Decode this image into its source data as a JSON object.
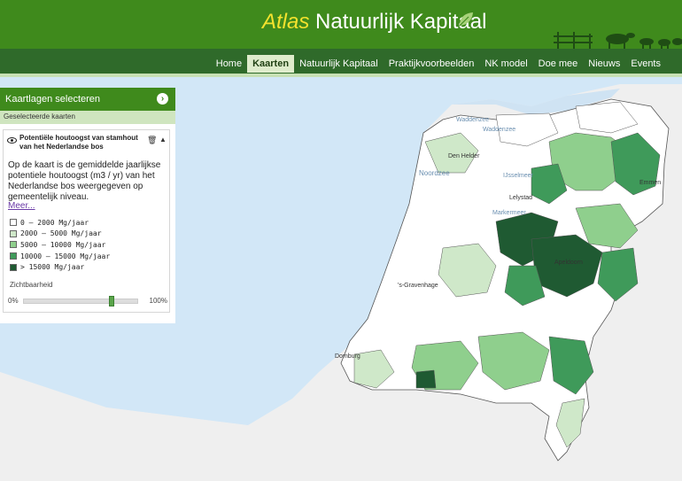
{
  "header": {
    "title_atlas": "Atlas",
    "title_rest": "Natuurlijk Kapitaal",
    "brand_color": "#3f8a1c",
    "accent_color": "#f3e22e"
  },
  "nav": {
    "items": [
      {
        "label": "Home",
        "active": false
      },
      {
        "label": "Kaarten",
        "active": true
      },
      {
        "label": "Natuurlijk Kapitaal",
        "active": false
      },
      {
        "label": "Praktijkvoorbeelden",
        "active": false
      },
      {
        "label": "NK model",
        "active": false
      },
      {
        "label": "Doe mee",
        "active": false
      },
      {
        "label": "Nieuws",
        "active": false
      },
      {
        "label": "Events",
        "active": false
      }
    ]
  },
  "panel": {
    "heading": "Kaartlagen selecteren",
    "subheading": "Geselecteerde kaarten",
    "layer_title": "Potentiële houtoogst van stamhout van het Nederlandse bos",
    "description": "Op de kaart is de gemiddelde jaarlijkse potentiele houtoogst (m3 / yr) van het Nederlandse bos weergegeven op gemeentelijk niveau.",
    "more_link": "Meer...",
    "legend": [
      {
        "label": "0 – 2000 Mg/jaar",
        "color": "#ffffff"
      },
      {
        "label": "2000 – 5000 Mg/jaar",
        "color": "#cfe8c9"
      },
      {
        "label": "5000 – 10000 Mg/jaar",
        "color": "#8fcf8d"
      },
      {
        "label": "10000 – 15000 Mg/jaar",
        "color": "#3f9a5a"
      },
      {
        "label": "> 15000 Mg/jaar",
        "color": "#1f5a32"
      }
    ],
    "opacity_label": "Zichtbaarheid",
    "opacity_min": "0%",
    "opacity_max": "100%",
    "opacity_value": 0.78
  },
  "map": {
    "labels": {
      "waddenzee_1": "Waddenzee",
      "waddenzee_2": "Waddenzee",
      "noordzee": "Noordzee",
      "ijsselmeer": "IJsselmeer",
      "markermeer": "Markermeer",
      "den_helder": "Den Helder",
      "lelystad": "Lelystad",
      "apeldoorn": "Apeldoorn",
      "s_gravenhage": "'s-Gravenhage",
      "emmen": "Emmen",
      "domburg": "Domburg"
    },
    "sea_color": "#d2e7f7",
    "land_color": "#efefef"
  }
}
